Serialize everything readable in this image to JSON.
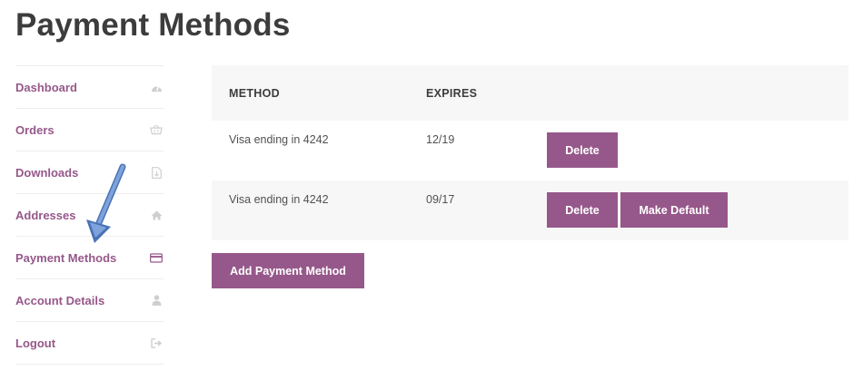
{
  "page": {
    "title": "Payment Methods"
  },
  "sidebar": {
    "items": [
      {
        "label": "Dashboard",
        "icon": "dashboard-icon"
      },
      {
        "label": "Orders",
        "icon": "basket-icon"
      },
      {
        "label": "Downloads",
        "icon": "file-download-icon"
      },
      {
        "label": "Addresses",
        "icon": "home-icon"
      },
      {
        "label": "Payment Methods",
        "icon": "credit-card-icon",
        "active": true
      },
      {
        "label": "Account Details",
        "icon": "user-icon"
      },
      {
        "label": "Logout",
        "icon": "sign-out-icon"
      }
    ]
  },
  "table": {
    "headers": {
      "method": "METHOD",
      "expires": "EXPIRES"
    },
    "rows": [
      {
        "method": "Visa ending in 4242",
        "expires": "12/19",
        "delete_label": "Delete"
      },
      {
        "method": "Visa ending in 4242",
        "expires": "09/17",
        "delete_label": "Delete",
        "default_label": "Make Default"
      }
    ]
  },
  "add_button": {
    "label": "Add Payment Method"
  },
  "colors": {
    "accent": "#96588a",
    "title": "#3c3c3c",
    "row_alt": "#f7f7f7",
    "icon": "#c8c8c8",
    "arrow": "#5b86c8"
  }
}
